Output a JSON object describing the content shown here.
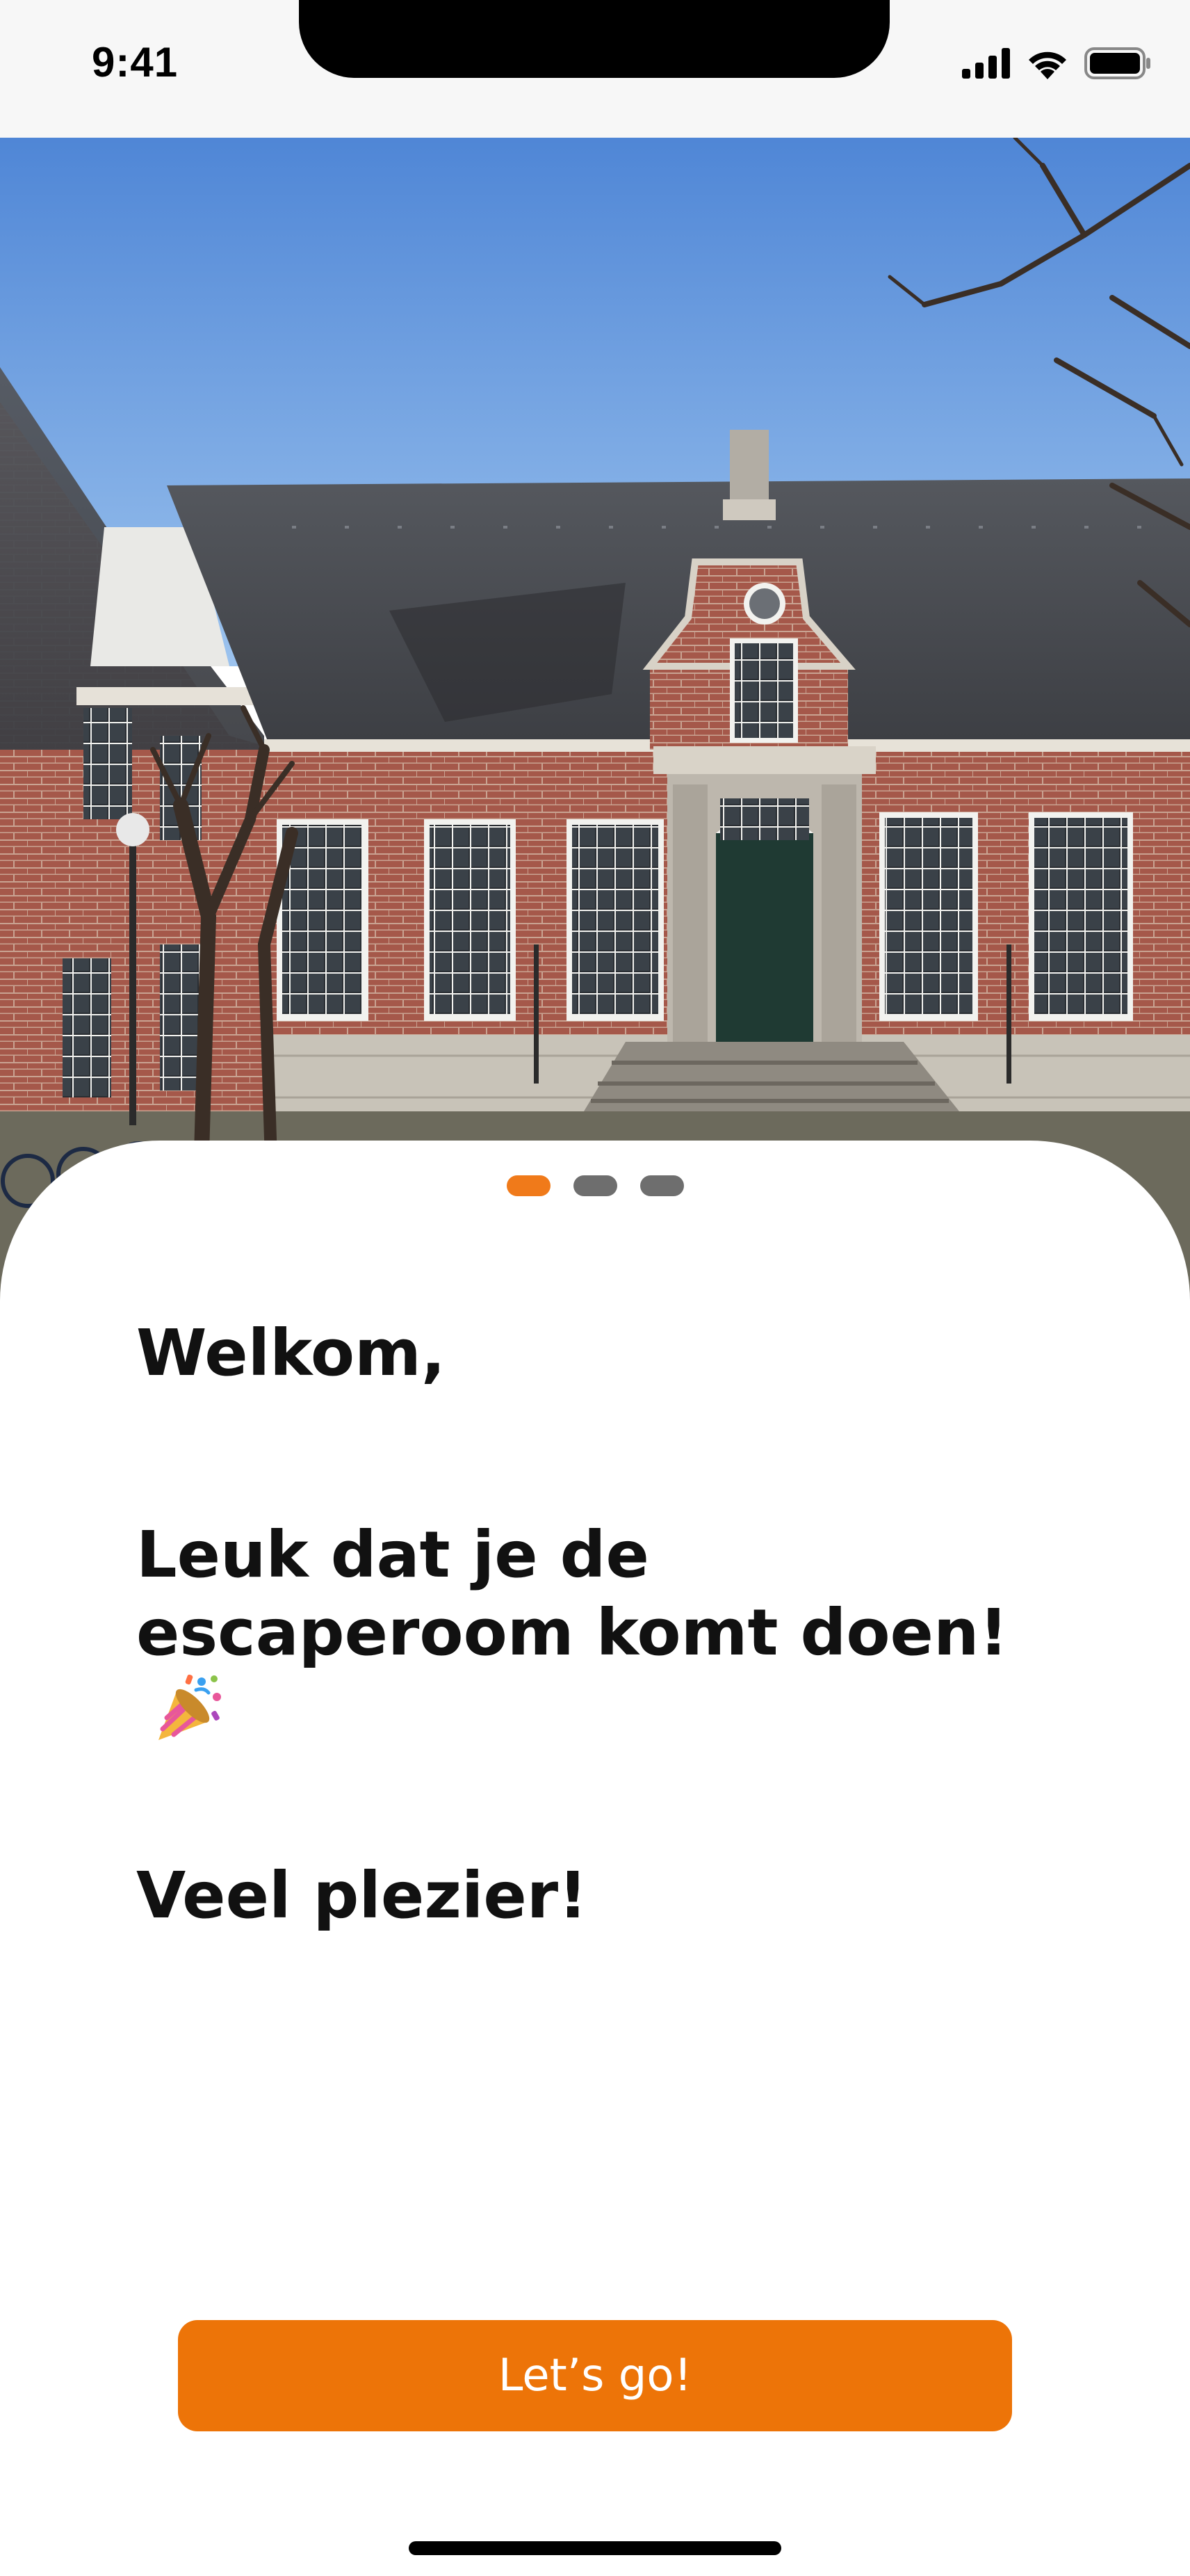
{
  "status_bar": {
    "time": "9:41",
    "icons": [
      "cellular-signal-icon",
      "wifi-icon",
      "battery-icon"
    ]
  },
  "hero": {
    "image": "historic-brick-building-photo"
  },
  "pager": {
    "count": 3,
    "active_index": 0,
    "active_color": "#f07a1a",
    "inactive_color": "#6e6e6e"
  },
  "content": {
    "greeting": "Welkom,",
    "message": "Leuk dat je de escaperoom komt doen!",
    "message_emoji": "party-popper-icon",
    "closing": "Veel plezier!"
  },
  "actions": {
    "primary_label": "Let’s go!",
    "primary_color": "#ed7408"
  }
}
